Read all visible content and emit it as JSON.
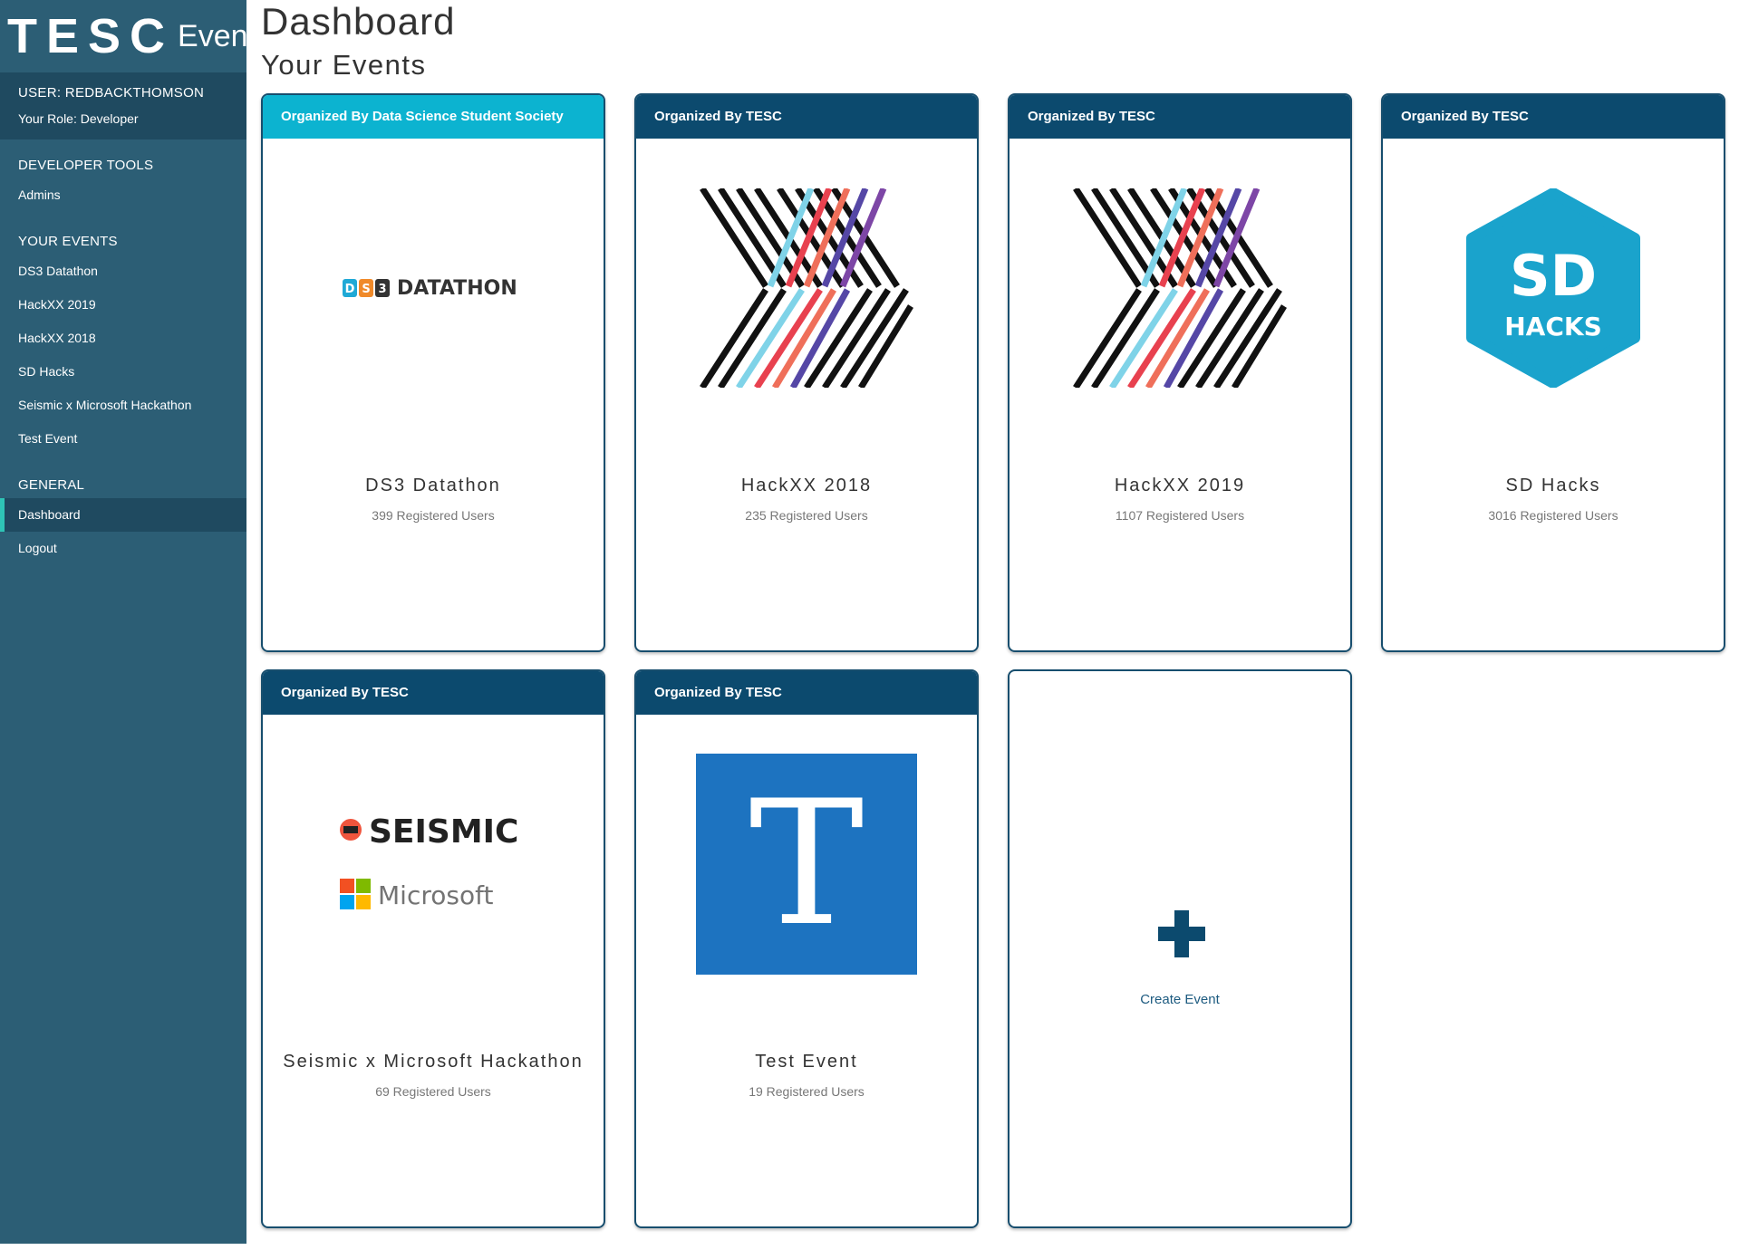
{
  "brand": {
    "logo_text": "TESC",
    "events_text": "Events"
  },
  "user": {
    "label": "USER: REDBACKTHOMSON",
    "role": "Your Role: Developer"
  },
  "sidebar": {
    "developer_tools": {
      "title": "DEVELOPER TOOLS",
      "items": [
        "Admins"
      ]
    },
    "your_events": {
      "title": "YOUR EVENTS",
      "items": [
        "DS3 Datathon",
        "HackXX 2019",
        "HackXX 2018",
        "SD Hacks",
        "Seismic x Microsoft Hackathon",
        "Test Event"
      ]
    },
    "general": {
      "title": "GENERAL",
      "items": [
        "Dashboard",
        "Logout"
      ],
      "active": "Dashboard"
    }
  },
  "page": {
    "title": "Dashboard",
    "subtitle": "Your Events"
  },
  "cards": [
    {
      "organizer": "Organized By Data Science Student Society",
      "name": "DS3 Datathon",
      "count": "399 Registered Users",
      "logo": "ds3-datathon-logo",
      "logo_text": "DATATHON",
      "header_color": "#0cb3d0"
    },
    {
      "organizer": "Organized By TESC",
      "name": "HackXX 2018",
      "count": "235 Registered Users",
      "logo": "hackxx-logo",
      "header_color": "#0c4a6e"
    },
    {
      "organizer": "Organized By TESC",
      "name": "HackXX 2019",
      "count": "1107 Registered Users",
      "logo": "hackxx-logo",
      "header_color": "#0c4a6e"
    },
    {
      "organizer": "Organized By TESC",
      "name": "SD Hacks",
      "count": "3016 Registered Users",
      "logo": "sd-hacks-logo",
      "logo_text": "SD HACKS",
      "header_color": "#0c4a6e"
    },
    {
      "organizer": "Organized By TESC",
      "name": "Seismic x Microsoft Hackathon",
      "count": "69 Registered Users",
      "logo": "seismic-microsoft-logo",
      "logo_text": "SEISMIC Microsoft",
      "header_color": "#0c4a6e"
    },
    {
      "organizer": "Organized By TESC",
      "name": "Test Event",
      "count": "19 Registered Users",
      "logo": "t-letter-logo",
      "logo_text": "T",
      "header_color": "#0c4a6e"
    }
  ],
  "create": {
    "label": "Create Event",
    "icon": "plus-icon"
  },
  "colors": {
    "sidebar": "#2c5e75",
    "sidebar_dark": "#1f4a60",
    "accent": "#2ec4b6",
    "card_header": "#0c4a6e",
    "card_header_cyan": "#0cb3d0"
  }
}
